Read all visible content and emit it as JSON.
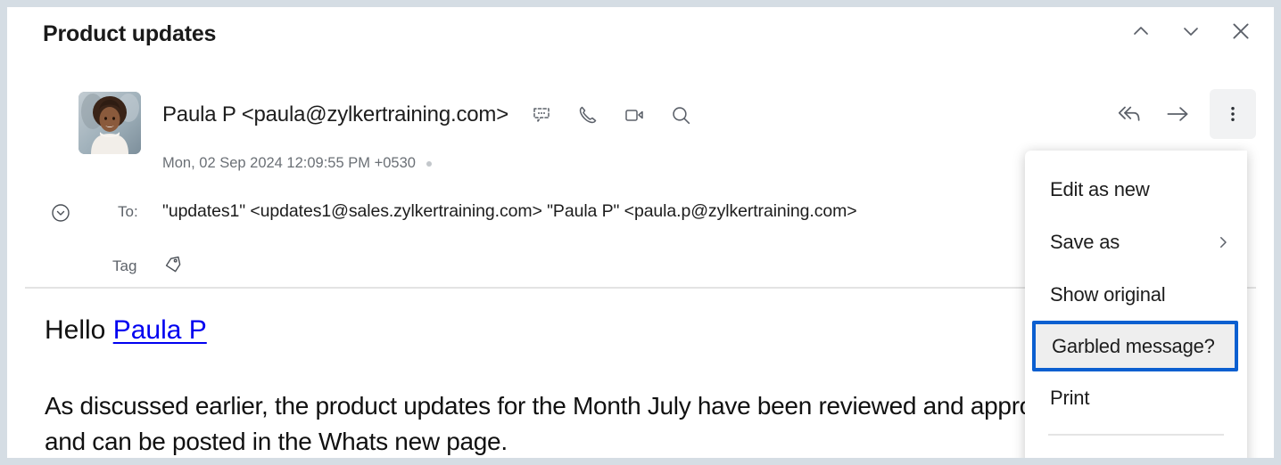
{
  "window": {
    "subject": "Product updates",
    "controls": [
      {
        "name": "previous-message",
        "icon": "chevron-up-icon"
      },
      {
        "name": "next-message",
        "icon": "chevron-down-icon"
      },
      {
        "name": "close",
        "icon": "close-icon"
      }
    ]
  },
  "message": {
    "sender": "Paula P <paula@zylkertraining.com>",
    "timestamp": "Mon, 02 Sep 2024 12:09:55 PM +0530",
    "to_label": "To:",
    "to_value": "\"updates1\" <updates1@sales.zylkertraining.com> \"Paula P\" <paula.p@zylkertraining.com>",
    "tag_label": "Tag",
    "quick_icons": [
      "chat-icon",
      "phone-icon",
      "video-icon",
      "search-icon"
    ],
    "reply_icons": [
      "reply-all-icon",
      "forward-icon",
      "more-options-icon"
    ]
  },
  "body": {
    "greeting_prefix": "Hello ",
    "greeting_link": "Paula P",
    "paragraph": "As discussed earlier, the product updates for the Month July have been reviewed and approved by the product and can be posted in the Whats new page."
  },
  "menu": {
    "items": [
      {
        "label": "Edit as new",
        "submenu": false,
        "highlighted": false
      },
      {
        "label": "Save as",
        "submenu": true,
        "highlighted": false
      },
      {
        "label": "Show original",
        "submenu": false,
        "highlighted": false
      },
      {
        "label": "Garbled message?",
        "submenu": false,
        "highlighted": true
      },
      {
        "label": "Print",
        "submenu": false,
        "highlighted": false
      }
    ]
  },
  "colors": {
    "highlight_border": "#0B5FD0",
    "highlight_fill": "#EEEEEE",
    "link": "#0000F0",
    "frame": "#D5DDE4"
  }
}
